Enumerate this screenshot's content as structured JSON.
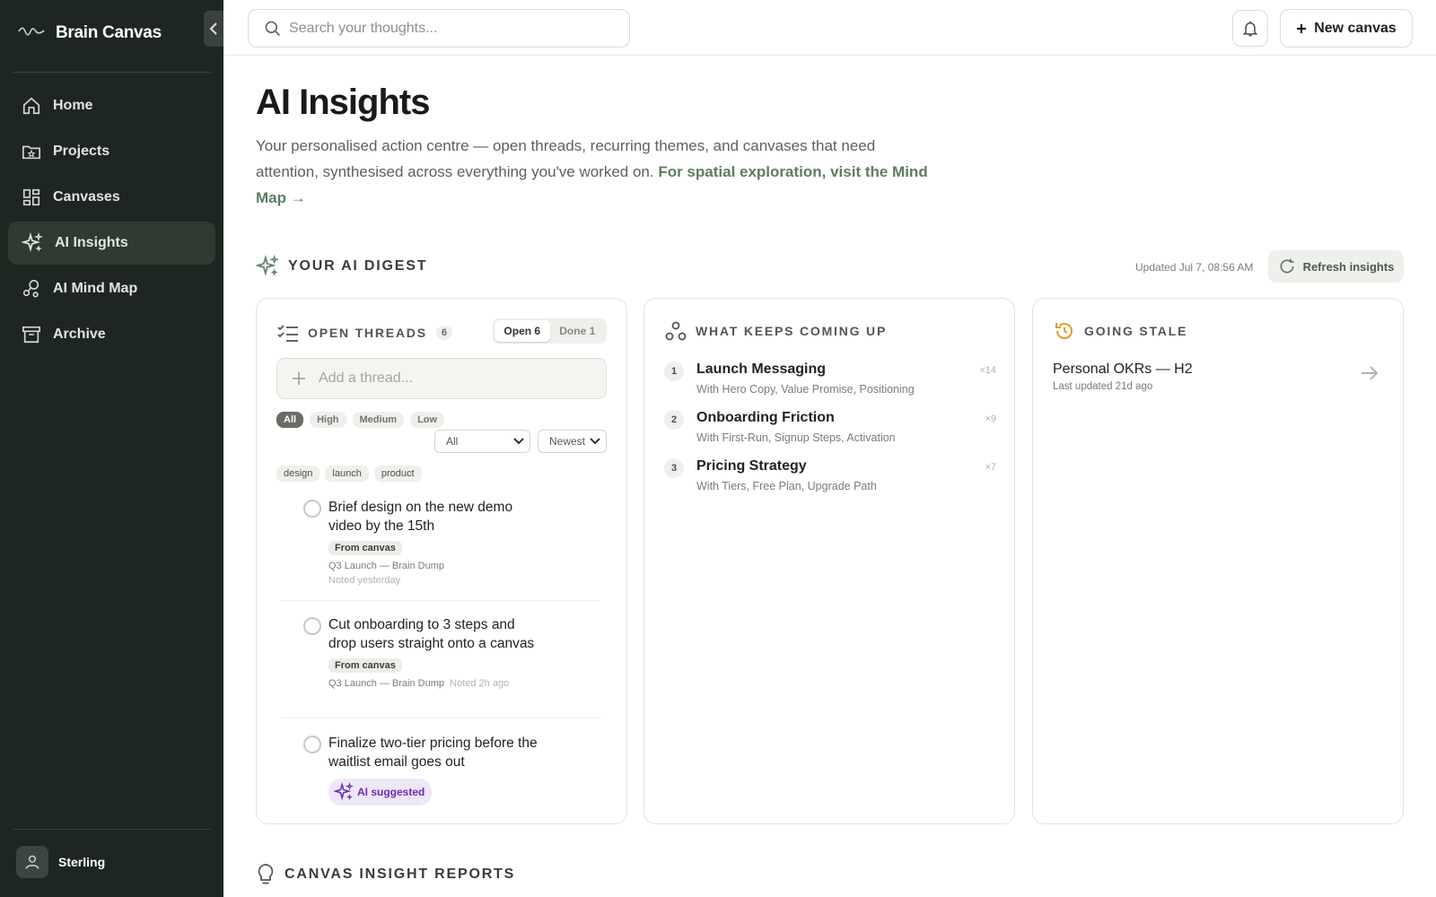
{
  "app": {
    "brand": "Brain Canvas",
    "user": "Sterling"
  },
  "sidebar": {
    "items": [
      {
        "label": "Home",
        "icon": "home-icon",
        "active": false
      },
      {
        "label": "Projects",
        "icon": "folder-star-icon",
        "active": false
      },
      {
        "label": "Canvases",
        "icon": "grid-icon",
        "active": false
      },
      {
        "label": "AI Insights",
        "icon": "sparkle-icon",
        "active": true
      },
      {
        "label": "AI Mind Map",
        "icon": "mind-map-icon",
        "active": false
      },
      {
        "label": "Archive",
        "icon": "archive-icon",
        "active": false
      }
    ]
  },
  "topbar": {
    "search_placeholder": "Search your thoughts...",
    "new_canvas": "New canvas"
  },
  "page": {
    "title": "AI Insights",
    "lead": "Your personalised action centre — open threads, recurring themes, and canvases that need attention, synthesised across everything you've worked on. ",
    "lead_link": "For spatial exploration, visit the Mind Map →"
  },
  "digest": {
    "title": "YOUR AI DIGEST",
    "updated": "Updated Jul 7, 08:56 AM",
    "refresh": "Refresh insights"
  },
  "threads": {
    "title": "OPEN THREADS",
    "count": "6",
    "seg_open": "Open 6",
    "seg_done": "Done 1",
    "add_placeholder": "Add a thread...",
    "priorities": [
      "All",
      "High",
      "Medium",
      "Low"
    ],
    "filter_select": "All",
    "sort_select": "Newest",
    "tags": [
      "design",
      "launch",
      "product"
    ],
    "items": [
      {
        "title": "Brief design on the new demo video by the 15th",
        "source": "From canvas",
        "canvas": "Q3 Launch — Brain Dump",
        "noted": "Noted yesterday"
      },
      {
        "title": "Cut onboarding to 3 steps and drop users straight onto a canvas",
        "source": "From canvas",
        "canvas": "Q3 Launch — Brain Dump",
        "noted": "Noted 2h ago"
      },
      {
        "title": "Finalize two-tier pricing before the waitlist email goes out",
        "ai_label": "AI suggested"
      }
    ]
  },
  "recurring": {
    "title": "WHAT KEEPS COMING UP",
    "items": [
      {
        "num": "1",
        "name": "Launch Messaging",
        "with": "With Hero Copy, Value Promise, Positioning",
        "count": "×14"
      },
      {
        "num": "2",
        "name": "Onboarding Friction",
        "with": "With First-Run, Signup Steps, Activation",
        "count": "×9"
      },
      {
        "num": "3",
        "name": "Pricing Strategy",
        "with": "With Tiers, Free Plan, Upgrade Path",
        "count": "×7"
      }
    ]
  },
  "stale": {
    "title": "GOING STALE",
    "item_name": "Personal OKRs — H2",
    "item_sub": "Last updated 21d ago"
  },
  "reports": {
    "title": "CANVAS INSIGHT REPORTS"
  },
  "colors": {
    "sidebar_bg": "#1e2621",
    "accent_green": "#5d7d62",
    "stale_orange": "#e89a2a",
    "ai_purple": "#6a2fb1"
  }
}
